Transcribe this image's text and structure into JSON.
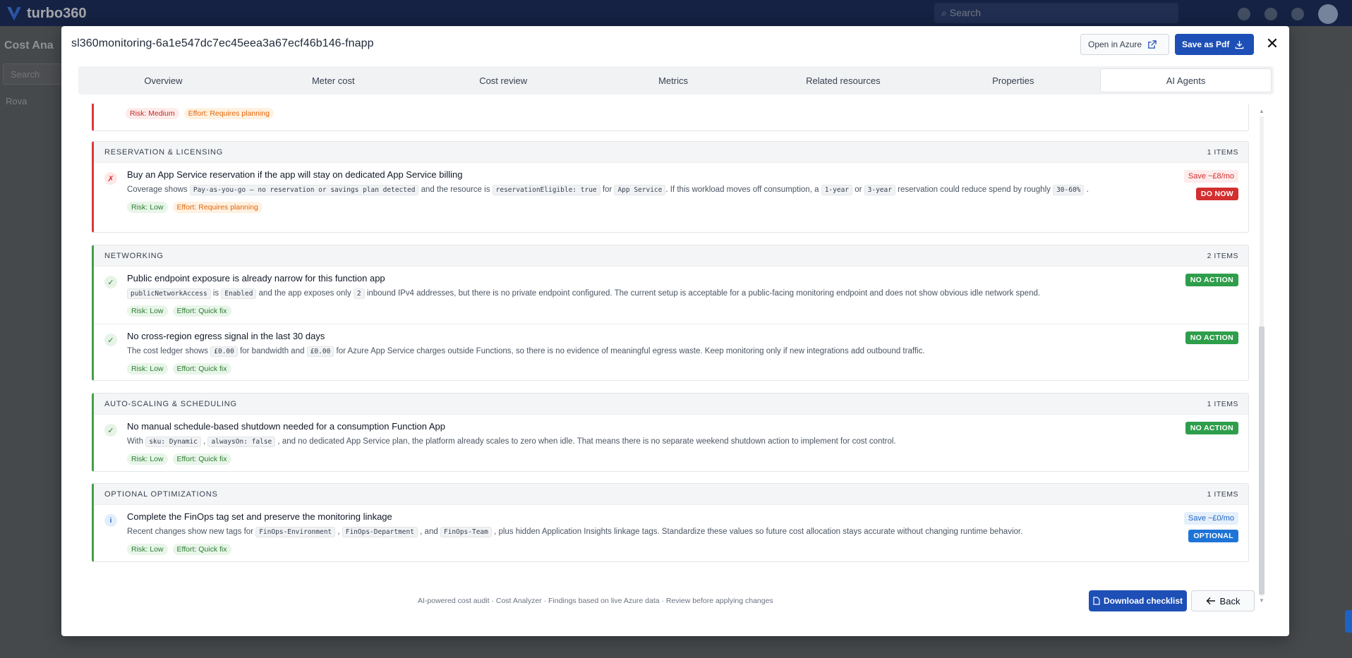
{
  "app": {
    "brand": "turbo360",
    "search_placeholder": "Search",
    "page_title": "Cost Ana",
    "tree_label": "Rova",
    "side_search": "Search"
  },
  "modal": {
    "title": "sl360monitoring-6a1e547dc7ec45eea3a67ecf46b146-fnapp",
    "open_azure_label": "Open in Azure",
    "save_pdf_label": "Save as Pdf",
    "close_glyph": "✕"
  },
  "tabs": [
    "Overview",
    "Meter cost",
    "Cost review",
    "Metrics",
    "Related resources",
    "Properties",
    "AI Agents"
  ],
  "active_tab": "AI Agents",
  "top_partial": {
    "risk": "Risk: Medium",
    "effort": "Effort: Requires planning"
  },
  "sections": [
    {
      "title": "RESERVATION & LICENSING",
      "count": "1 ITEMS",
      "items": [
        {
          "title": "Buy an App Service reservation if the app will stay on dedicated App Service billing",
          "desc": [
            "Coverage shows ",
            "`Pay-as-you-go — no reservation or savings plan detected",
            " and the resource is ",
            "`reservationEligible: true",
            " for ",
            "`App Service",
            ". If this workload moves off consumption, a ",
            "`1-year",
            " or ",
            "`3-year",
            " reservation could reduce spend by roughly ",
            "`30-60%",
            " ."
          ],
          "risk": "Risk: Low",
          "effort": "Effort: Requires planning",
          "save": "Save ~£8/mo",
          "action": "DO NOW"
        }
      ]
    },
    {
      "title": "NETWORKING",
      "count": "2 ITEMS",
      "items": [
        {
          "title": "Public endpoint exposure is already narrow for this function app",
          "desc": [
            "`publicNetworkAccess",
            " is ",
            "`Enabled",
            " and the app exposes only ",
            "`2",
            " inbound IPv4 addresses, but there is no private endpoint configured. The current setup is acceptable for a public-facing monitoring endpoint and does not show obvious idle network spend."
          ],
          "risk": "Risk: Low",
          "effort": "Effort: Quick fix",
          "action": "NO ACTION"
        },
        {
          "title": "No cross-region egress signal in the last 30 days",
          "desc": [
            "The cost ledger shows ",
            "`£0.00",
            " for bandwidth and ",
            "`£0.00",
            " for Azure App Service charges outside Functions, so there is no evidence of meaningful egress waste. Keep monitoring only if new integrations add outbound traffic."
          ],
          "risk": "Risk: Low",
          "effort": "Effort: Quick fix",
          "action": "NO ACTION"
        }
      ]
    },
    {
      "title": "AUTO-SCALING & SCHEDULING",
      "count": "1 ITEMS",
      "items": [
        {
          "title": "No manual schedule-based shutdown needed for a consumption Function App",
          "desc": [
            "With ",
            "`sku: Dynamic",
            " , ",
            "`alwaysOn: false",
            " , and no dedicated App Service plan, the platform already scales to zero when idle. That means there is no separate weekend shutdown action to implement for cost control."
          ],
          "risk": "Risk: Low",
          "effort": "Effort: Quick fix",
          "action": "NO ACTION"
        }
      ]
    },
    {
      "title": "OPTIONAL OPTIMIZATIONS",
      "count": "1 ITEMS",
      "items": [
        {
          "title": "Complete the FinOps tag set and preserve the monitoring linkage",
          "desc": [
            "Recent changes show new tags for ",
            "`FinOps-Environment",
            " , ",
            "`FinOps-Department",
            " , and ",
            "`FinOps-Team",
            " , plus hidden Application Insights linkage tags. Standardize these values so future cost allocation stays accurate without changing runtime behavior."
          ],
          "risk": "Risk: Low",
          "effort": "Effort: Quick fix",
          "save": "Save ~£0/mo",
          "action": "OPTIONAL"
        }
      ]
    }
  ],
  "footer": {
    "note": "AI-powered cost audit · Cost Analyzer · Findings based on live Azure data · Review before applying changes",
    "download_label": "Download checklist",
    "back_label": "Back"
  },
  "colors": {
    "primary": "#1e4fb6",
    "danger": "#d32f2f",
    "success": "#2e9e4b",
    "info": "#1e74d6"
  }
}
